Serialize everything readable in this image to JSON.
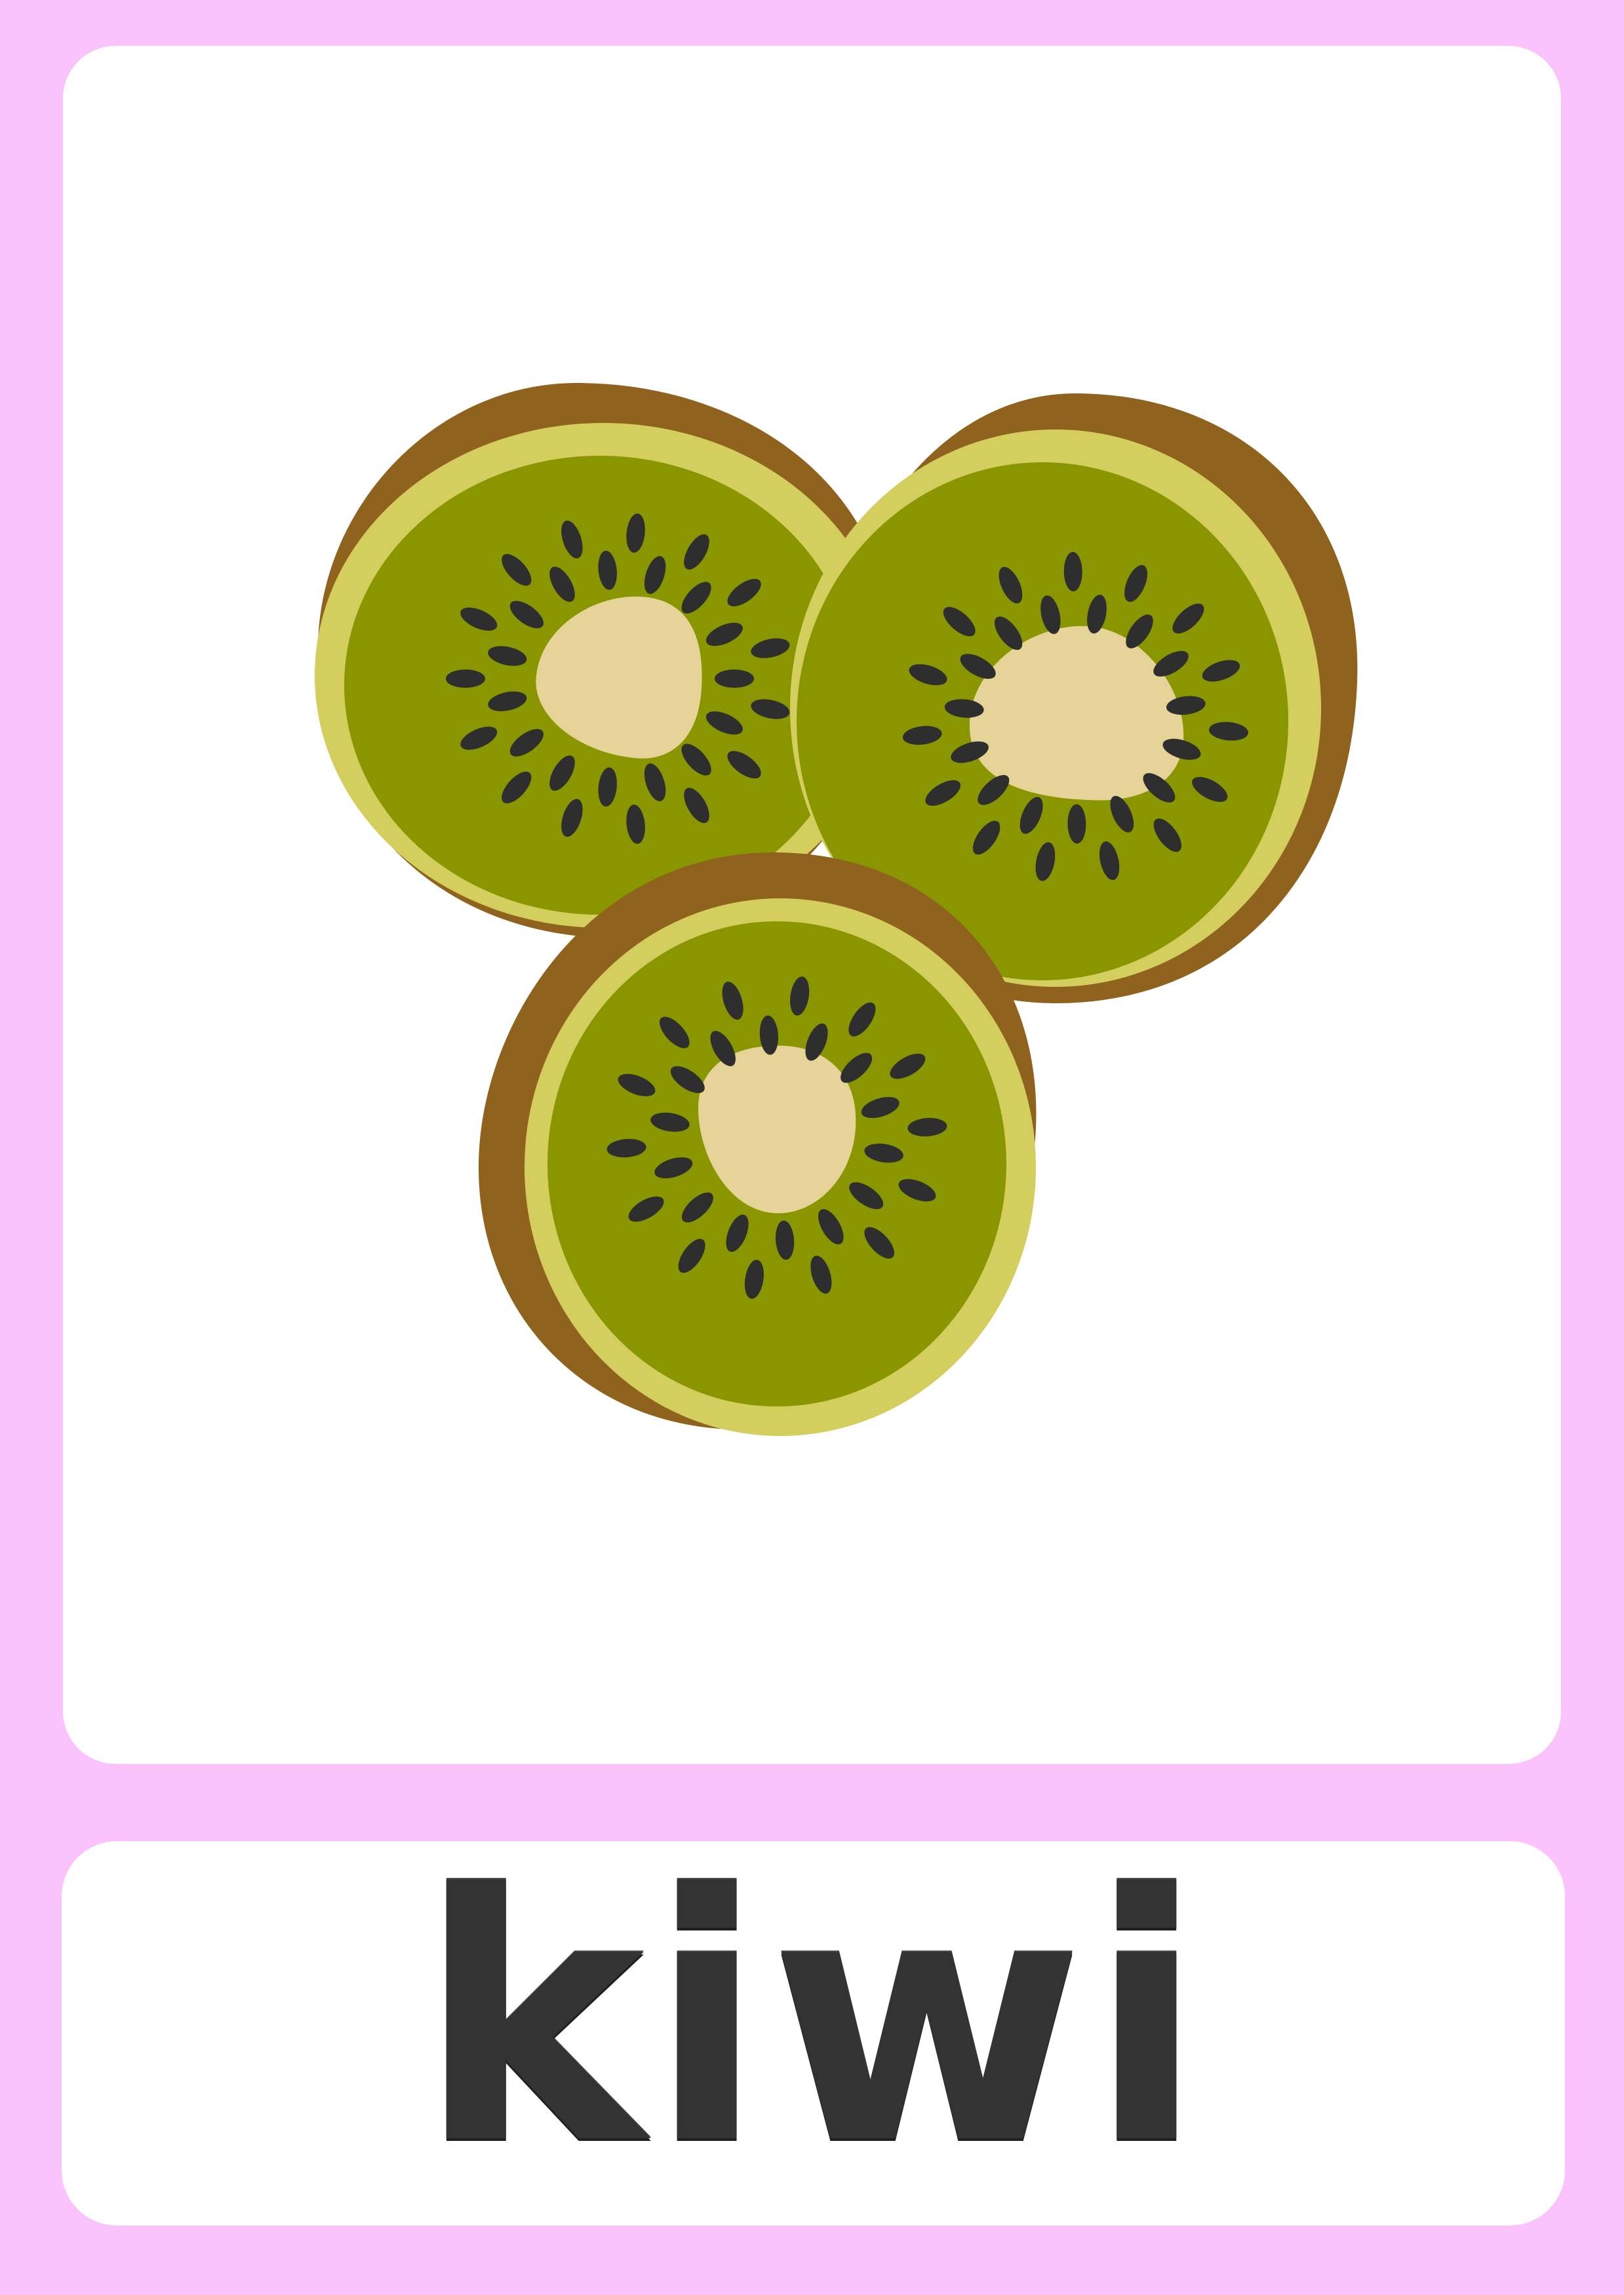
{
  "card": {
    "word": "kiwi"
  },
  "illustration": {
    "subject": "kiwi-slices",
    "count": 3
  },
  "colors": {
    "frame": "#FBC3FB",
    "panel": "#FFFFFF",
    "skin": "#8F621E",
    "rind": "#D3CE5D",
    "flesh": "#899600",
    "core": "#E5D398",
    "seed": "#2E2E2E",
    "text": "#333333"
  }
}
